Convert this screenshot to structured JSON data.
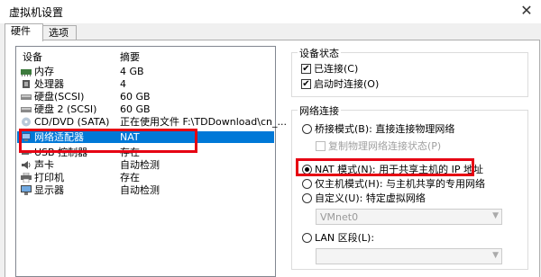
{
  "window": {
    "title": "虚拟机设置",
    "close": "✕"
  },
  "tabs": [
    "硬件",
    "选项"
  ],
  "device_list": {
    "headers": [
      "设备",
      "摘要"
    ],
    "rows": [
      {
        "name": "内存",
        "summary": "4 GB",
        "icon": "memory-icon"
      },
      {
        "name": "处理器",
        "summary": "4",
        "icon": "processor-icon"
      },
      {
        "name": "硬盘(SCSI)",
        "summary": "60 GB",
        "icon": "hard-disk-icon"
      },
      {
        "name": "硬盘 2 (SCSI)",
        "summary": "60 GB",
        "icon": "hard-disk-icon"
      },
      {
        "name": "CD/DVD (SATA)",
        "summary": "正在使用文件 F:\\TDDownload\\cn_...",
        "icon": "cd-dvd-icon"
      },
      {
        "name": "网络适配器",
        "summary": "NAT",
        "icon": "network-adapter-icon",
        "selected": true
      },
      {
        "name": "USB 控制器",
        "summary": "存在",
        "icon": "usb-icon"
      },
      {
        "name": "声卡",
        "summary": "自动检测",
        "icon": "sound-card-icon"
      },
      {
        "name": "打印机",
        "summary": "存在",
        "icon": "printer-icon"
      },
      {
        "name": "显示器",
        "summary": "自动检测",
        "icon": "display-icon"
      }
    ]
  },
  "device_status": {
    "legend": "设备状态",
    "connected": "已连接(C)",
    "connect_on_start": "启动时连接(O)"
  },
  "network": {
    "legend": "网络连接",
    "bridged": "桥接模式(B): 直接连接物理网络",
    "replicate": "复制物理网络连接状态(P)",
    "nat": "NAT 模式(N): 用于共享主机的 IP 地址",
    "host_only": "仅主机模式(H): 与主机共享的专用网络",
    "custom": "自定义(U): 特定虚拟网络",
    "custom_value": "VMnet0",
    "lan": "LAN 区段(L):",
    "lan_value": ""
  },
  "colors": {
    "highlight": "#e60012",
    "selection": "#0078d7"
  }
}
